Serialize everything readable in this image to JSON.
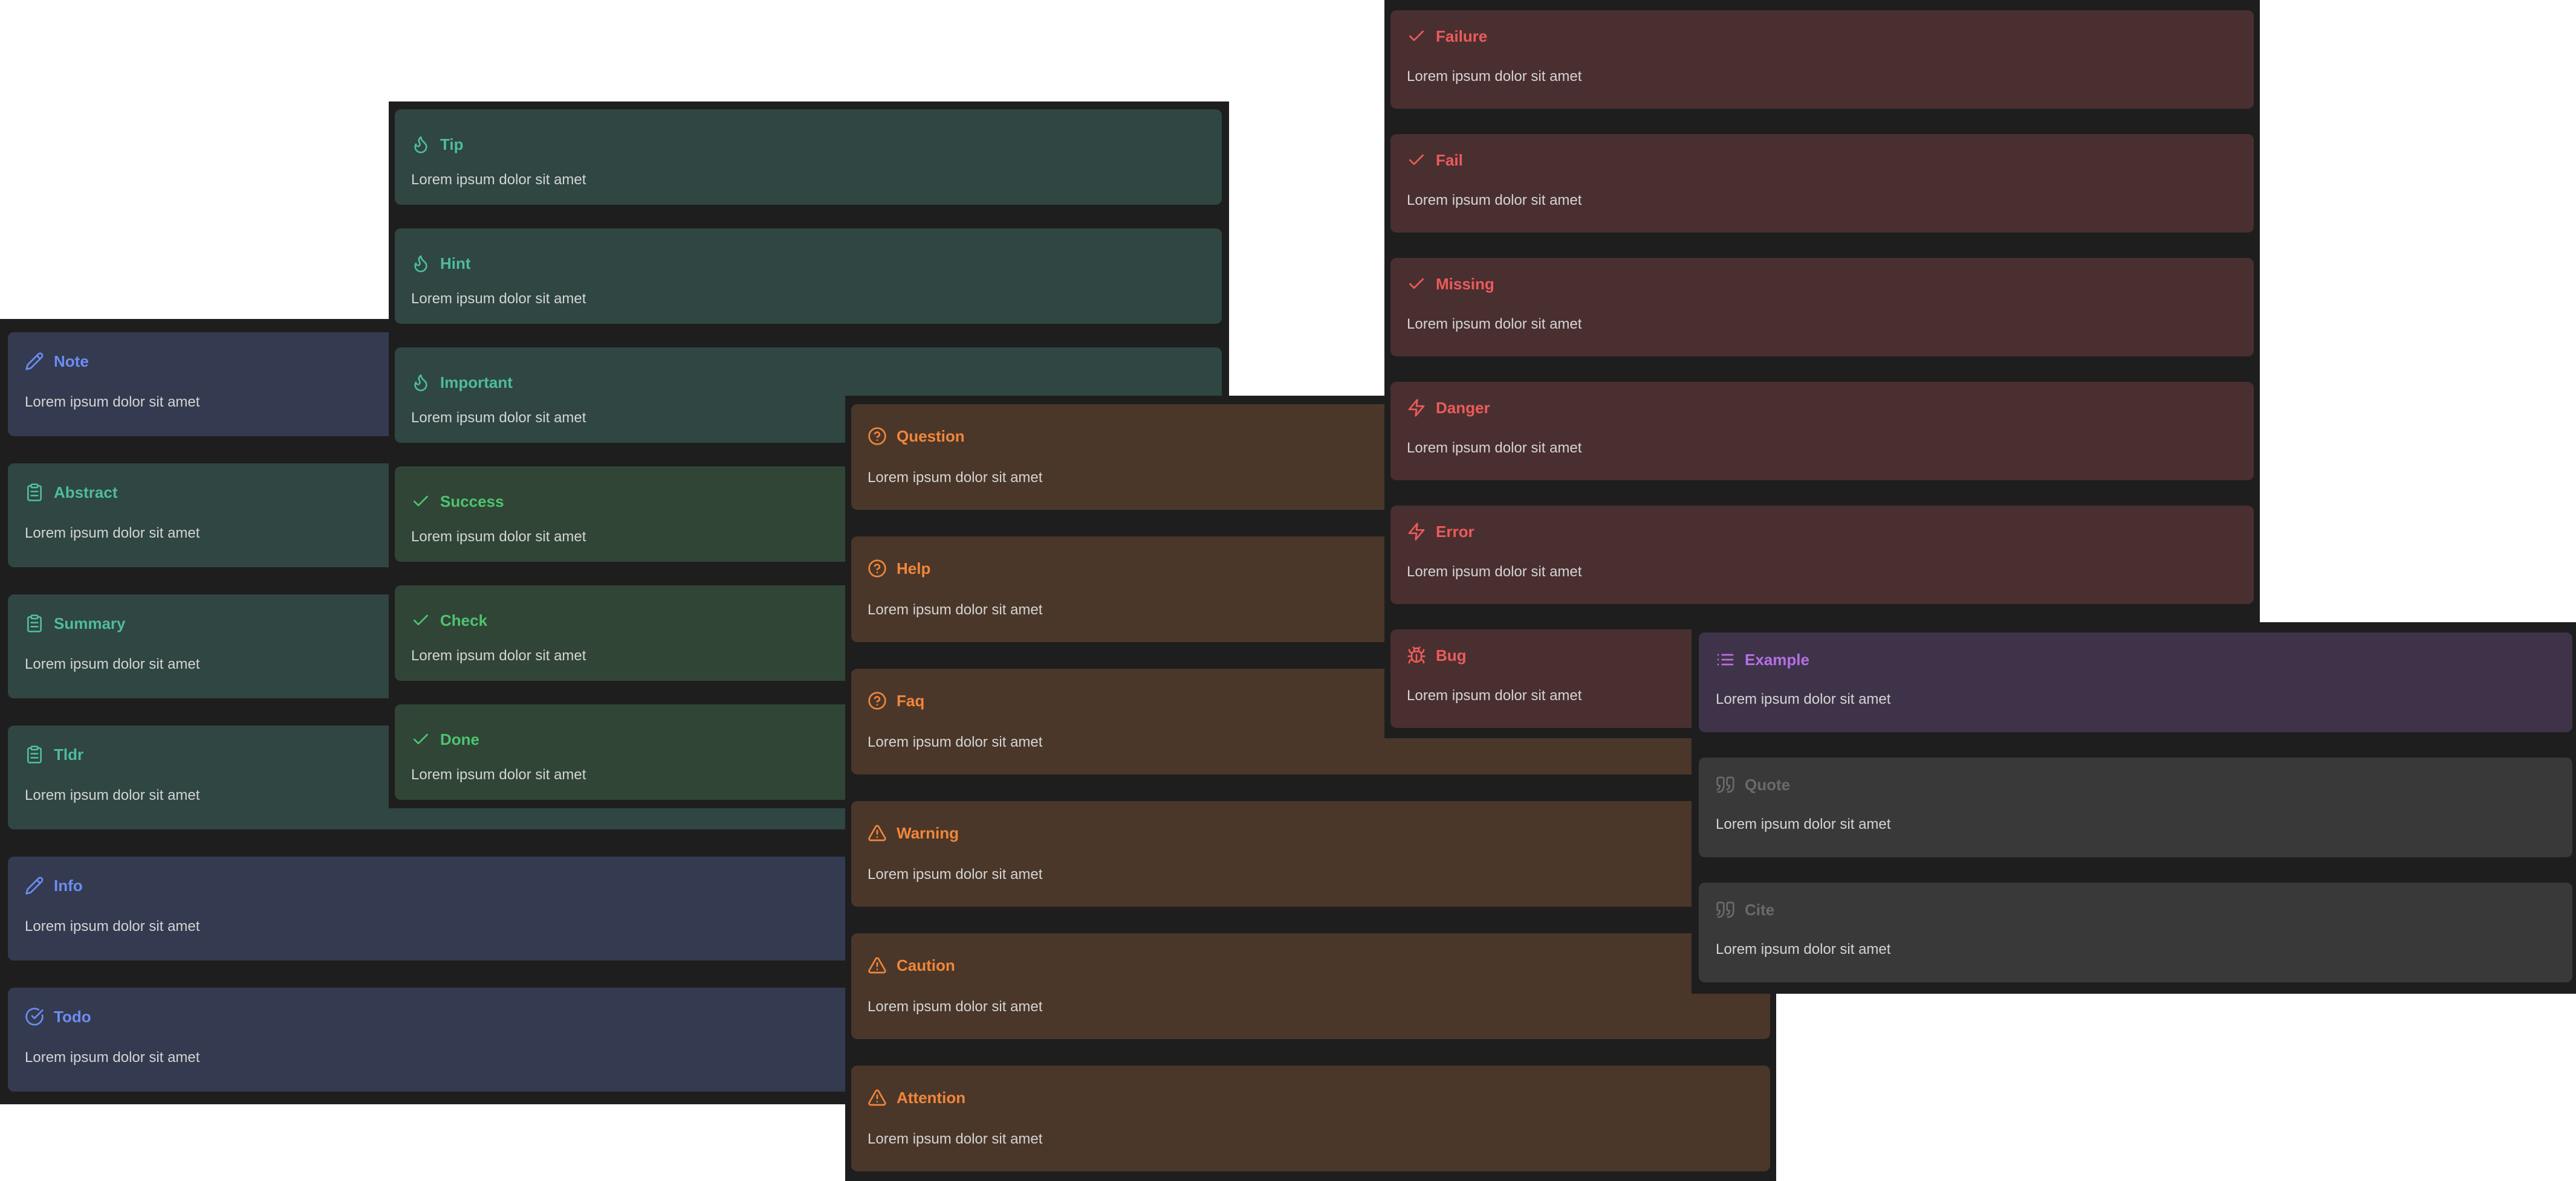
{
  "body_text": "Lorem ipsum dolor sit amet",
  "colors": {
    "blue": "#6d8cf3",
    "teal": "#4fbba0",
    "green": "#4dc46f",
    "orange": "#f2863a",
    "red": "#ec5b5b",
    "purple": "#b66fe5",
    "gray": "#6a6a6a"
  },
  "panels": {
    "left": {
      "callouts": [
        {
          "title": "Note",
          "icon": "pencil-icon",
          "theme": "blue"
        },
        {
          "title": "Abstract",
          "icon": "clipboard-icon",
          "theme": "teal"
        },
        {
          "title": "Summary",
          "icon": "clipboard-icon",
          "theme": "teal"
        },
        {
          "title": "Tldr",
          "icon": "clipboard-icon",
          "theme": "teal"
        },
        {
          "title": "Info",
          "icon": "pencil-icon",
          "theme": "blue"
        },
        {
          "title": "Todo",
          "icon": "check-circle-icon",
          "theme": "blue"
        }
      ]
    },
    "tip": {
      "callouts": [
        {
          "title": "Tip",
          "icon": "flame-icon",
          "theme": "teal"
        },
        {
          "title": "Hint",
          "icon": "flame-icon",
          "theme": "teal"
        },
        {
          "title": "Important",
          "icon": "flame-icon",
          "theme": "teal"
        },
        {
          "title": "Success",
          "icon": "check-icon",
          "theme": "green"
        },
        {
          "title": "Check",
          "icon": "check-icon",
          "theme": "green"
        },
        {
          "title": "Done",
          "icon": "check-icon",
          "theme": "green"
        }
      ]
    },
    "question": {
      "callouts": [
        {
          "title": "Question",
          "icon": "help-circle-icon",
          "theme": "orange"
        },
        {
          "title": "Help",
          "icon": "help-circle-icon",
          "theme": "orange"
        },
        {
          "title": "Faq",
          "icon": "help-circle-icon",
          "theme": "orange"
        },
        {
          "title": "Warning",
          "icon": "alert-triangle-icon",
          "theme": "orange"
        },
        {
          "title": "Caution",
          "icon": "alert-triangle-icon",
          "theme": "orange"
        },
        {
          "title": "Attention",
          "icon": "alert-triangle-icon",
          "theme": "orange"
        }
      ]
    },
    "failure": {
      "callouts": [
        {
          "title": "Failure",
          "icon": "check-icon",
          "theme": "red"
        },
        {
          "title": "Fail",
          "icon": "check-icon",
          "theme": "red"
        },
        {
          "title": "Missing",
          "icon": "check-icon",
          "theme": "red"
        },
        {
          "title": "Danger",
          "icon": "zap-icon",
          "theme": "red"
        },
        {
          "title": "Error",
          "icon": "zap-icon",
          "theme": "red"
        },
        {
          "title": "Bug",
          "icon": "bug-icon",
          "theme": "red"
        }
      ]
    },
    "example": {
      "callouts": [
        {
          "title": "Example",
          "icon": "list-icon",
          "theme": "purple"
        },
        {
          "title": "Quote",
          "icon": "quote-icon",
          "theme": "gray"
        },
        {
          "title": "Cite",
          "icon": "quote-icon",
          "theme": "gray"
        }
      ]
    }
  }
}
